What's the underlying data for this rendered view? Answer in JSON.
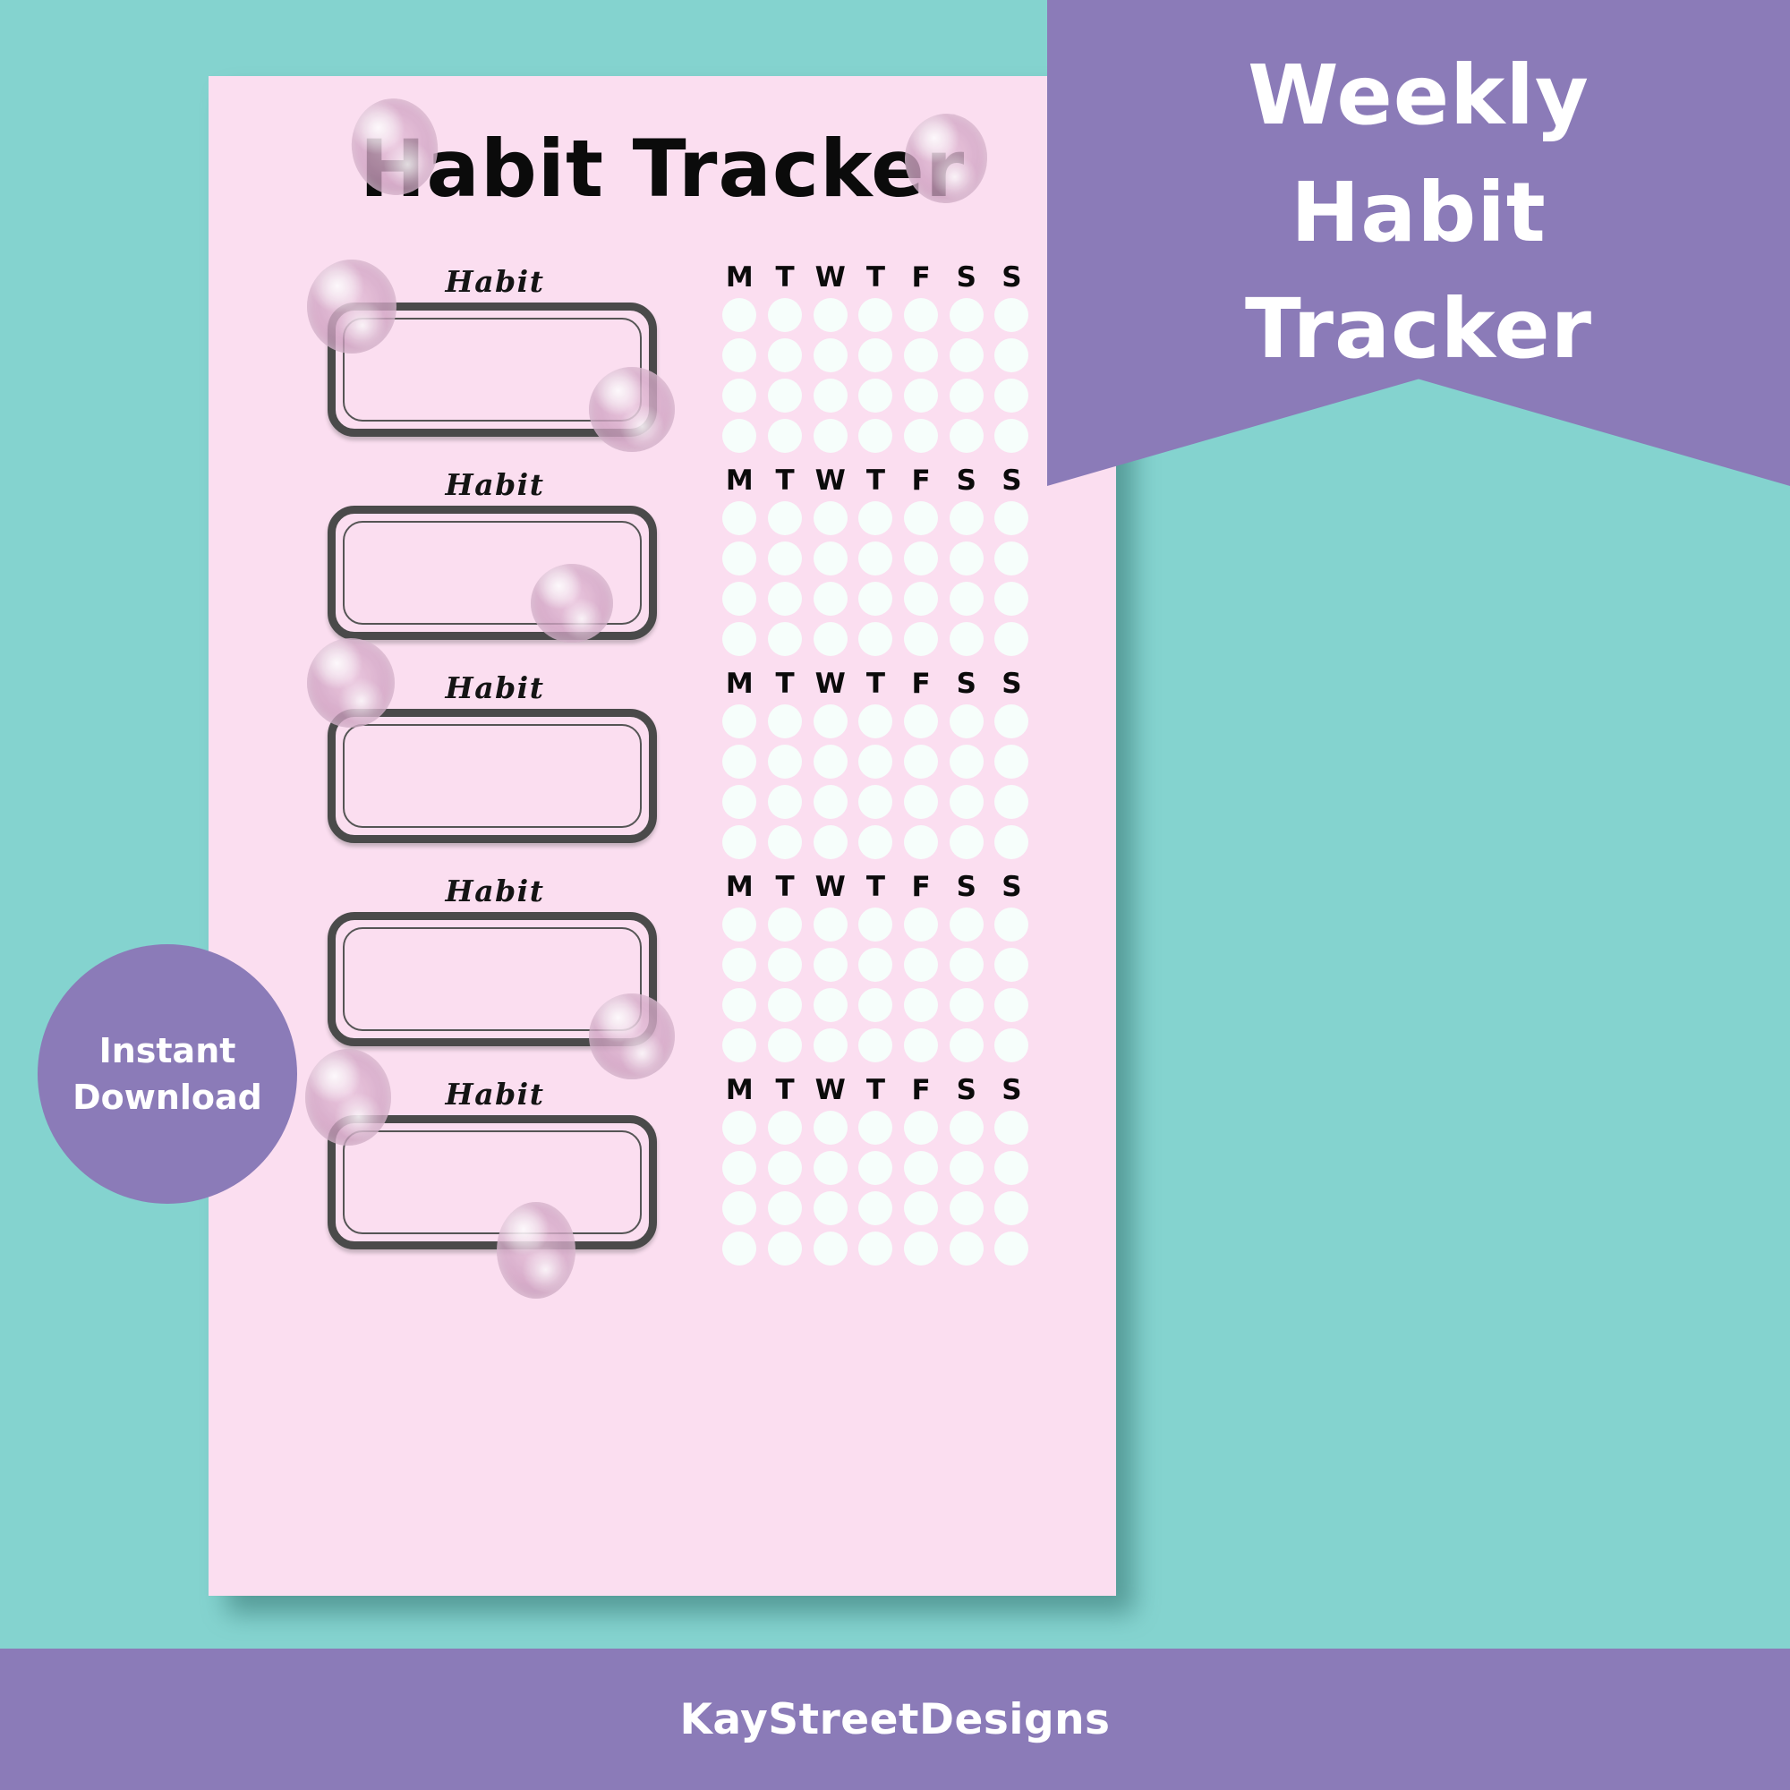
{
  "colors": {
    "background_teal": "#84D3CF",
    "page_pink": "#FBDEF0",
    "accent_purple": "#8B7BB8",
    "box_border": "#4A4A4A",
    "dot_fill": "#F6FEFB",
    "page_shadow": "#2F6E6B",
    "text_dark": "#0B0B0B",
    "text_white": "#FFFFFF"
  },
  "sheet": {
    "title": "Habit Tracker",
    "habit_label": "Habit",
    "day_headers": [
      "M",
      "T",
      "W",
      "T",
      "F",
      "S",
      "S"
    ],
    "habit_rows_count": 5,
    "dot_rows_per_habit": 4,
    "dot_columns_per_habit": 7,
    "habits": [
      {
        "label": "Habit",
        "value": ""
      },
      {
        "label": "Habit",
        "value": ""
      },
      {
        "label": "Habit",
        "value": ""
      },
      {
        "label": "Habit",
        "value": ""
      },
      {
        "label": "Habit",
        "value": ""
      }
    ]
  },
  "banner": {
    "line1": "Weekly",
    "line2": "Habit",
    "line3": "Tracker"
  },
  "badge": {
    "line1": "Instant",
    "line2": "Download"
  },
  "footer": {
    "shop_name": "KayStreetDesigns"
  },
  "decorations": {
    "pearl_count": 9,
    "pearl_name": "pearl-bubble"
  }
}
